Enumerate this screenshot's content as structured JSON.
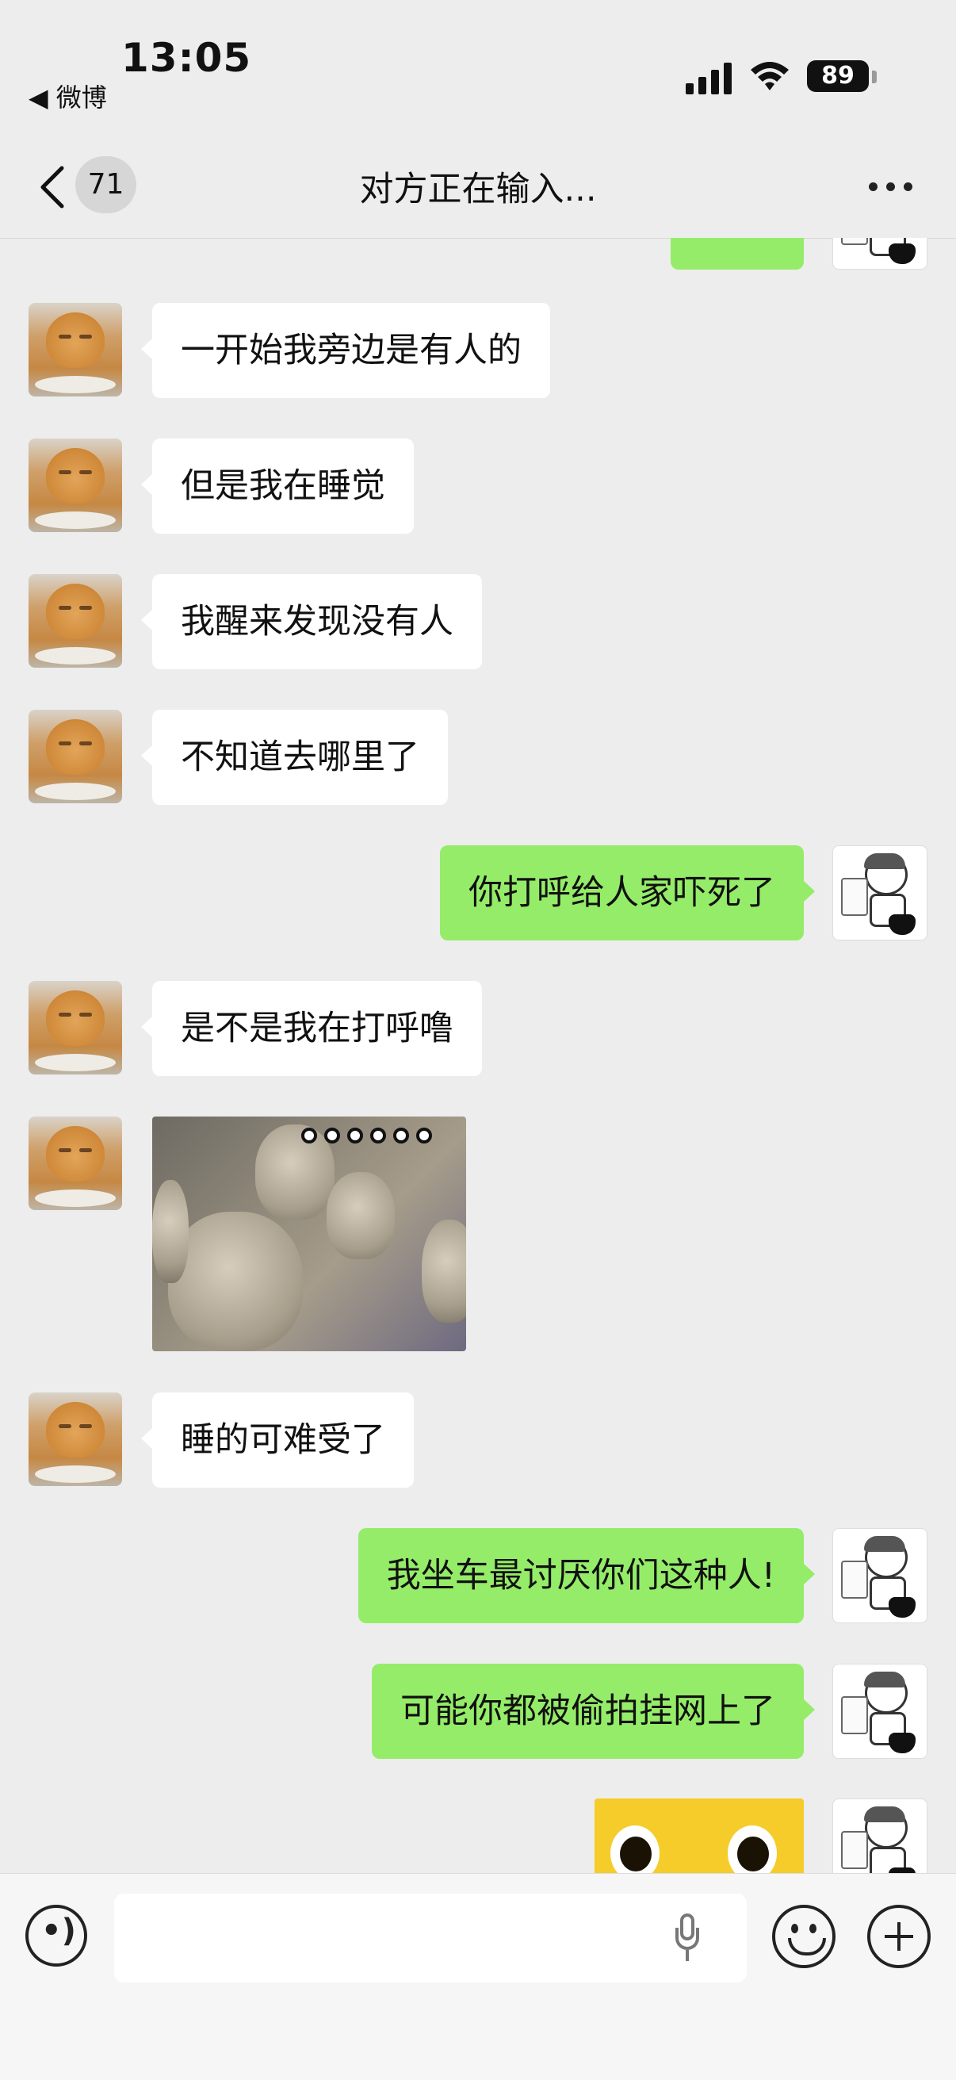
{
  "status_bar": {
    "time": "13:05",
    "back_app": "◀ 微博",
    "battery": "89",
    "icons": [
      "cellular-signal-icon",
      "wifi-icon",
      "battery-icon"
    ]
  },
  "nav": {
    "unread_count": "71",
    "title": "对方正在输入...",
    "icons": [
      "back-chevron-icon",
      "more-icon"
    ]
  },
  "colors": {
    "chat_background": "#EDEDED",
    "incoming_bubble": "#FFFFFF",
    "outgoing_bubble": "#95EC69"
  },
  "messages": [
    {
      "from": "other",
      "type": "text",
      "text": "一开始我旁边是有人的"
    },
    {
      "from": "other",
      "type": "text",
      "text": "但是我在睡觉"
    },
    {
      "from": "other",
      "type": "text",
      "text": "我醒来发现没有人"
    },
    {
      "from": "other",
      "type": "text",
      "text": "不知道去哪里了"
    },
    {
      "from": "me",
      "type": "text",
      "text": "你打呼给人家吓死了"
    },
    {
      "from": "other",
      "type": "text",
      "text": "是不是我在打呼噜"
    },
    {
      "from": "other",
      "type": "sticker",
      "text": "○○○○○○"
    },
    {
      "from": "other",
      "type": "text",
      "text": "睡的可难受了"
    },
    {
      "from": "me",
      "type": "text",
      "text": "我坐车最讨厌你们这种人!"
    },
    {
      "from": "me",
      "type": "text",
      "text": "可能你都被偷拍挂网上了"
    },
    {
      "from": "me",
      "type": "sticker",
      "text": ""
    }
  ],
  "input_bar": {
    "placeholder": "",
    "icons": [
      "voice-icon",
      "mic-icon",
      "emoji-icon",
      "plus-icon"
    ]
  }
}
